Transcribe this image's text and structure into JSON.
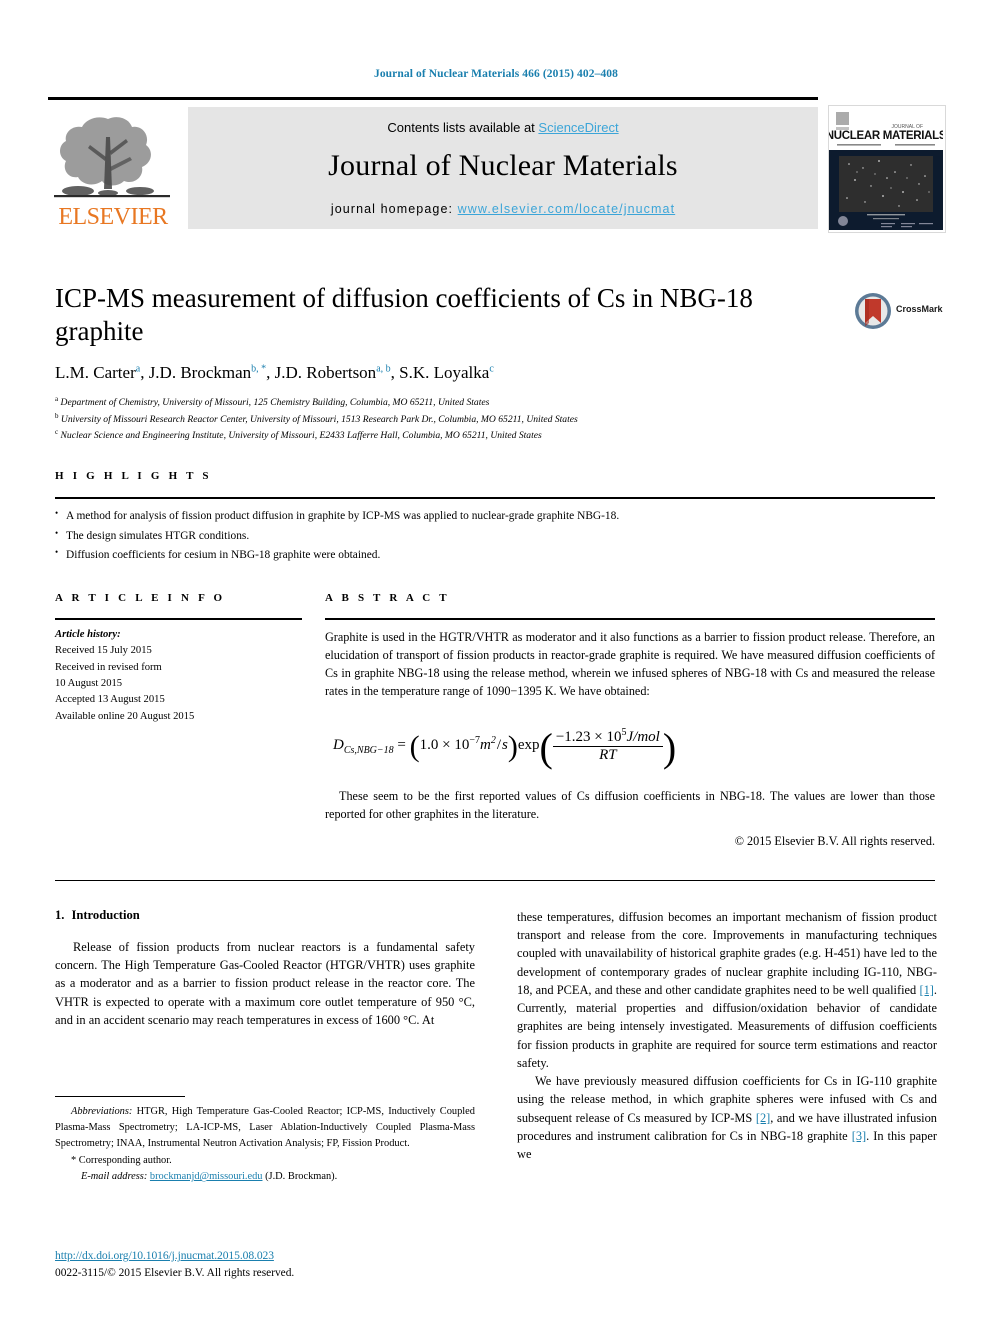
{
  "running_head": "Journal of Nuclear Materials 466 (2015) 402–408",
  "masthead": {
    "contents_prefix": "Contents lists available at ",
    "sciencedirect": "ScienceDirect",
    "journal_title": "Journal of Nuclear Materials",
    "homepage_label": "journal homepage: ",
    "homepage_url": "www.elsevier.com/locate/jnucmat",
    "publisher": "ELSEVIER",
    "cover_title_small": "JOURNAL OF",
    "cover_title": "NUCLEAR MATERIALS",
    "accent_color": "#3ca5d8",
    "publisher_color": "#e87722"
  },
  "article": {
    "title": "ICP-MS measurement of diffusion coefficients of Cs in NBG-18 graphite",
    "crossmark_label": "CrossMark",
    "authors": [
      {
        "name": "L.M. Carter",
        "marks": "a"
      },
      {
        "name": "J.D. Brockman",
        "marks": "b, *"
      },
      {
        "name": "J.D. Robertson",
        "marks": "a, b"
      },
      {
        "name": "S.K. Loyalka",
        "marks": "c"
      }
    ],
    "affiliations": [
      {
        "mark": "a",
        "text": "Department of Chemistry, University of Missouri, 125 Chemistry Building, Columbia, MO 65211, United States"
      },
      {
        "mark": "b",
        "text": "University of Missouri Research Reactor Center, University of Missouri, 1513 Research Park Dr., Columbia, MO 65211, United States"
      },
      {
        "mark": "c",
        "text": "Nuclear Science and Engineering Institute, University of Missouri, E2433 Lafferre Hall, Columbia, MO 65211, United States"
      }
    ]
  },
  "highlights": {
    "heading": "H I G H L I G H T S",
    "items": [
      "A method for analysis of fission product diffusion in graphite by ICP-MS was applied to nuclear-grade graphite NBG-18.",
      "The design simulates HTGR conditions.",
      "Diffusion coefficients for cesium in NBG-18 graphite were obtained."
    ]
  },
  "article_info": {
    "heading": "A R T I C L E   I N F O",
    "history_label": "Article history:",
    "lines": [
      "Received 15 July 2015",
      "Received in revised form",
      "10 August 2015",
      "Accepted 13 August 2015",
      "Available online 20 August 2015"
    ]
  },
  "abstract": {
    "heading": "A B S T R A C T",
    "paragraph": "Graphite is used in the HGTR/VHTR as moderator and it also functions as a barrier to fission product release. Therefore, an elucidation of transport of fission products in reactor-grade graphite is required. We have measured diffusion coefficients of Cs in graphite NBG-18 using the release method, wherein we infused spheres of NBG-18 with Cs and measured the release rates in the temperature range of 1090−1395 K. We have obtained:",
    "equation": {
      "lhs": "D",
      "lhs_sub": "Cs,NBG−18",
      "equals": "=",
      "prefactor": "1.0 × 10",
      "prefactor_exp": "−7",
      "prefactor_units_m": "m",
      "prefactor_units_m_exp": "2",
      "prefactor_units_div": "/",
      "prefactor_units_s": "s",
      "exp_label": "exp",
      "numerator": "−1.23 × 10",
      "numerator_exp": "5",
      "numerator_units": "J/mol",
      "denominator": "RT"
    },
    "tail": "These seem to be the first reported values of Cs diffusion coefficients in NBG-18. The values are lower than those reported for other graphites in the literature.",
    "copyright": "© 2015 Elsevier B.V. All rights reserved."
  },
  "body": {
    "section_number": "1.",
    "section_title": "Introduction",
    "left_paragraph": "Release of fission products from nuclear reactors is a fundamental safety concern. The High Temperature Gas-Cooled Reactor (HTGR/VHTR) uses graphite as a moderator and as a barrier to fission product release in the reactor core. The VHTR is expected to operate with a maximum core outlet temperature of 950 °C, and in an accident scenario may reach temperatures in excess of 1600 °C. At",
    "right_paragraph_1_a": "these temperatures, diffusion becomes an important mechanism of fission product transport and release from the core. Improvements in manufacturing techniques coupled with unavailability of historical graphite grades (e.g. H-451) have led to the development of contemporary grades of nuclear graphite including IG-110, NBG-18, and PCEA, and these and other candidate graphites need to be well qualified ",
    "right_paragraph_1_ref": "[1]",
    "right_paragraph_1_b": ". Currently, material properties and diffusion/oxidation behavior of candidate graphites are being intensely investigated. Measurements of diffusion coefficients for fission products in graphite are required for source term estimations and reactor safety.",
    "right_paragraph_2_a": "We have previously measured diffusion coefficients for Cs in IG-110 graphite using the release method, in which graphite spheres were infused with Cs and subsequent release of Cs measured by ICP-MS ",
    "right_paragraph_2_ref1": "[2]",
    "right_paragraph_2_b": ", and we have illustrated infusion procedures and instrument calibration for Cs in NBG-18 graphite ",
    "right_paragraph_2_ref2": "[3]",
    "right_paragraph_2_c": ". In this paper we"
  },
  "footnotes": {
    "abbreviations_label": "Abbreviations:",
    "abbreviations_text": " HTGR, High Temperature Gas-Cooled Reactor; ICP-MS, Inductively Coupled Plasma-Mass Spectrometry; LA-ICP-MS, Laser Ablation-Inductively Coupled Plasma-Mass Spectrometry; INAA, Instrumental Neutron Activation Analysis; FP, Fission Product.",
    "corresponding": "* Corresponding author.",
    "email_label": "E-mail address:",
    "email_address": "brockmanjd@missouri.edu",
    "email_owner": " (J.D. Brockman).",
    "doi": "http://dx.doi.org/10.1016/j.jnucmat.2015.08.023",
    "issn_line": "0022-3115/© 2015 Elsevier B.V. All rights reserved."
  }
}
